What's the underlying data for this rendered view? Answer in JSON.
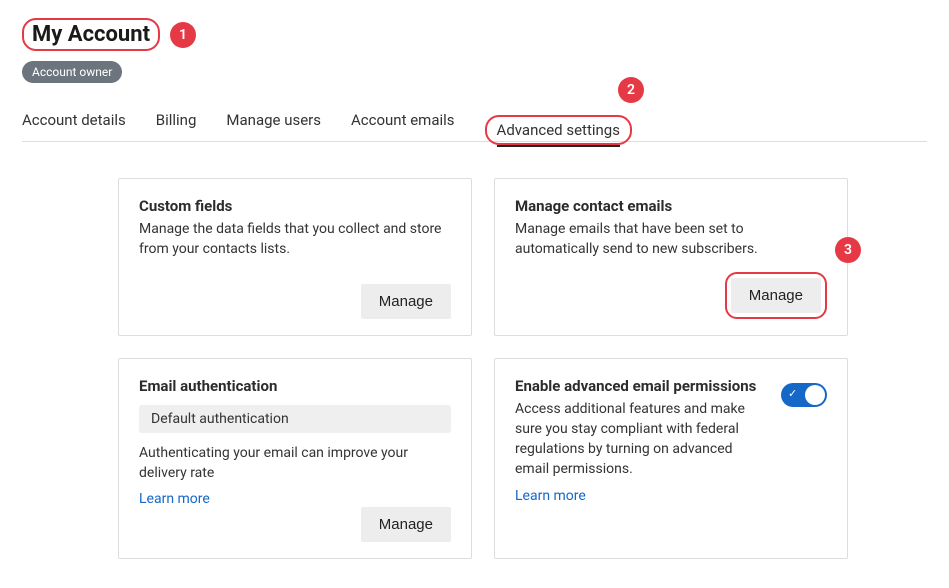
{
  "header": {
    "title": "My Account",
    "role_badge": "Account owner"
  },
  "annotations": {
    "badge1": "1",
    "badge2": "2",
    "badge3": "3"
  },
  "tabs": [
    {
      "label": "Account details",
      "active": false
    },
    {
      "label": "Billing",
      "active": false
    },
    {
      "label": "Manage users",
      "active": false
    },
    {
      "label": "Account emails",
      "active": false
    },
    {
      "label": "Advanced settings",
      "active": true
    }
  ],
  "cards": {
    "custom_fields": {
      "title": "Custom fields",
      "desc": "Manage the data fields that you collect and store from your contacts lists.",
      "button": "Manage"
    },
    "contact_emails": {
      "title": "Manage contact emails",
      "desc": "Manage emails that have been set to automatically send to new subscribers.",
      "button": "Manage"
    },
    "email_auth": {
      "title": "Email authentication",
      "chip": "Default authentication",
      "desc": "Authenticating your email can improve your delivery rate",
      "learn_more": "Learn more",
      "button": "Manage"
    },
    "advanced_permissions": {
      "title": "Enable advanced email permissions",
      "desc": "Access additional features and make sure you stay compliant with federal regulations by turning on advanced email permissions.",
      "learn_more": "Learn more",
      "toggle_on": true
    }
  }
}
